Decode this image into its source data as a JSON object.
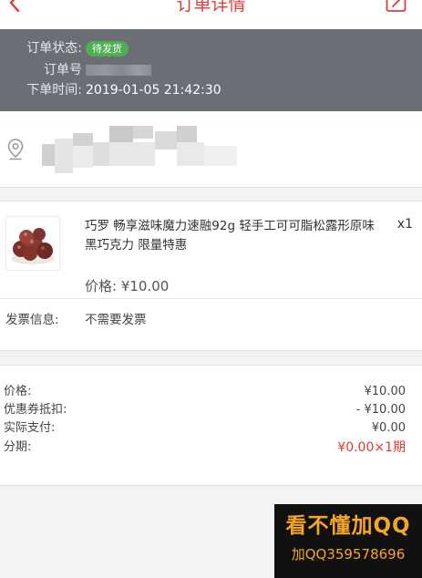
{
  "header": {
    "title": "订单详情"
  },
  "status": {
    "state_label": "订单状态:",
    "state_value": "待发货",
    "order_no_label": "订单号",
    "time_label": "下单时间:",
    "time_value": "2019-01-05 21:42:30"
  },
  "product": {
    "name": "巧罗 畅享滋味魔力速融92g 轻手工可可脂松露形原味黑巧克力 限量特惠",
    "quantity": "x1",
    "price": "价格: ¥10.00",
    "invoice_label": "发票信息:",
    "invoice_value": "不需要发票"
  },
  "summary": {
    "rows": [
      {
        "label": "价格:",
        "value": "¥10.00"
      },
      {
        "label": "优惠券抵扣:",
        "value": "- ¥10.00"
      },
      {
        "label": "实际支付:",
        "value": "¥0.00"
      },
      {
        "label": "分期:",
        "value": "¥0.00×1期"
      }
    ]
  },
  "watermark": {
    "line1": "看不懂加QQ",
    "line2": "加QQ359578696"
  },
  "colors": {
    "accent": "#e53935",
    "status_bg": "#6b6e75",
    "badge": "#4caf50"
  },
  "icons": {
    "back": "chevron-left-icon",
    "edit": "edit-icon",
    "location": "location-pin-icon"
  }
}
